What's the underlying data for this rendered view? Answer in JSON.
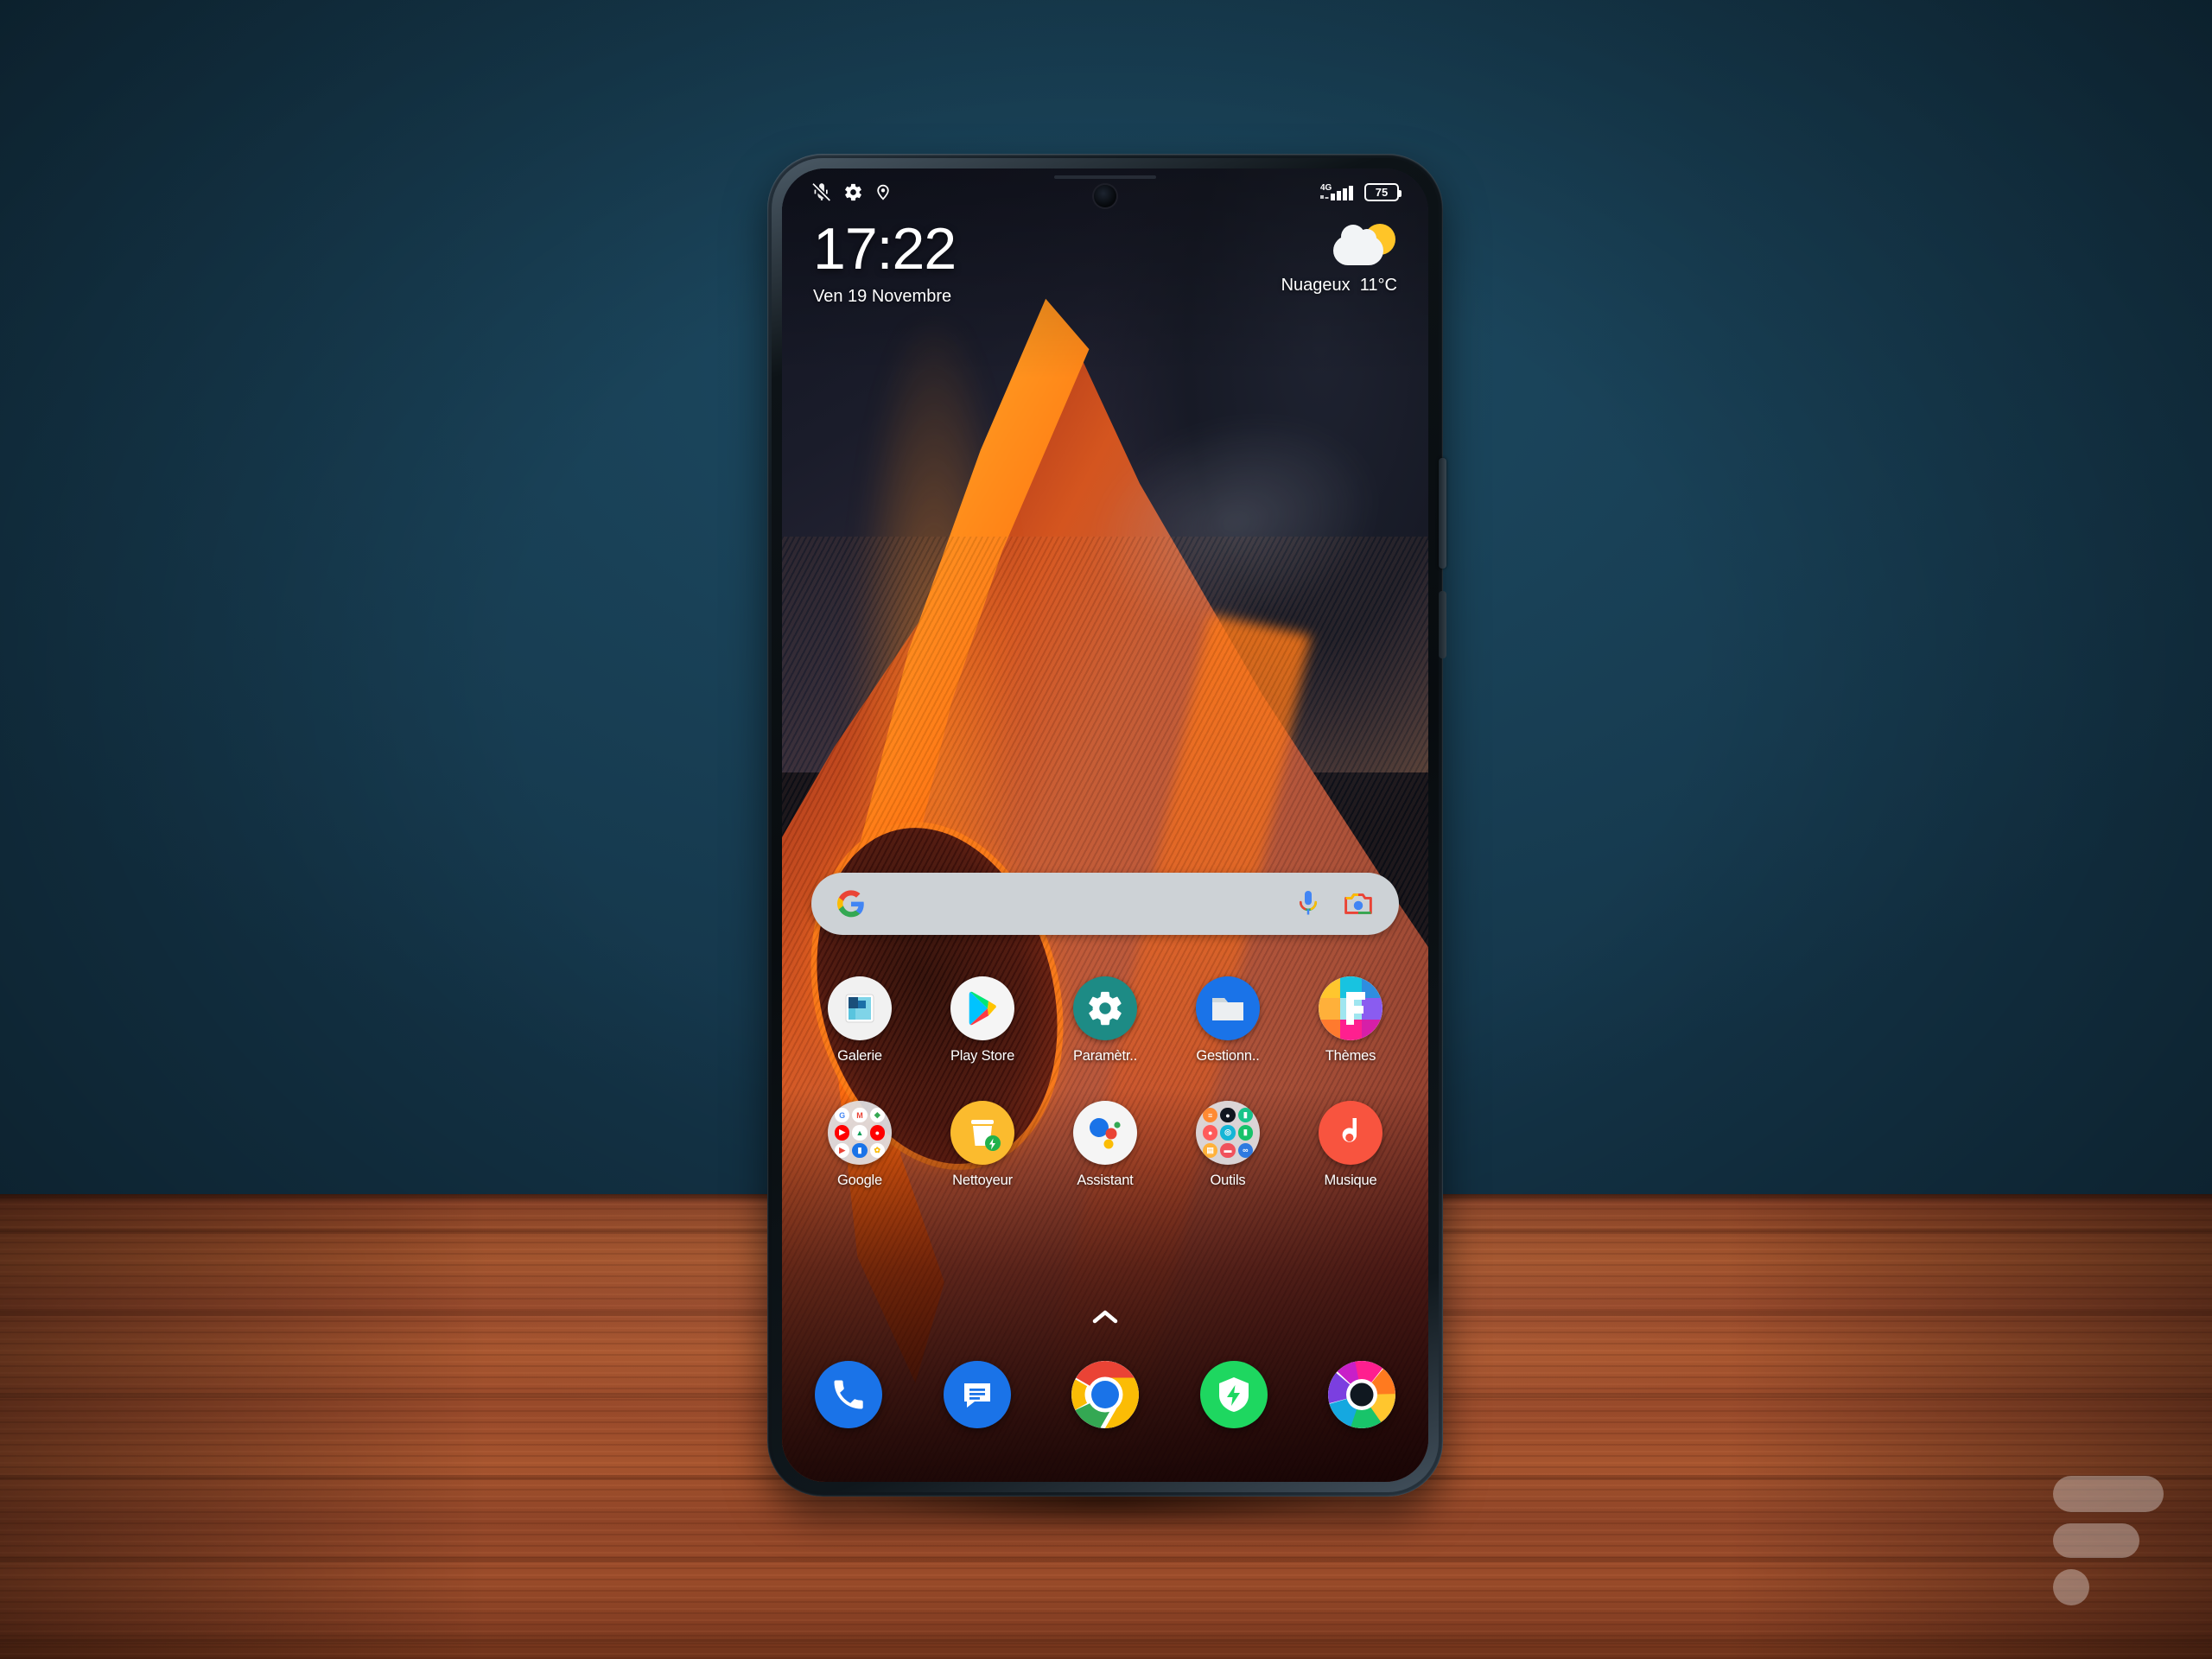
{
  "scene": {
    "background_wall_color": "#194157",
    "table_color": "#a0522c",
    "description": "Smartphone standing upright on a wooden table against a dark teal-blue wall"
  },
  "phone": {
    "device_type": "android-smartphone",
    "frame_color": "#0d1317"
  },
  "status_bar": {
    "left_icons": [
      {
        "name": "vibrate-off-icon",
        "glyph": "bell-muted"
      },
      {
        "name": "gear-icon",
        "glyph": "settings"
      },
      {
        "name": "location-pin-icon",
        "glyph": "location"
      }
    ],
    "network_label": "4G",
    "signal_bars": 4,
    "battery_percent": "75"
  },
  "clock_widget": {
    "time": "17:22",
    "date": "Ven 19 Novembre"
  },
  "weather_widget": {
    "condition": "Nuageux",
    "temperature": "11°C",
    "icon": "partly-cloudy-icon"
  },
  "search": {
    "placeholder": "",
    "value": "",
    "logo": "google-g-icon",
    "mic_icon": "microphone-icon",
    "lens_icon": "google-lens-icon",
    "background_color": "#cdd2d6"
  },
  "app_grid": {
    "rows": [
      {
        "apps": [
          {
            "label": "Galerie",
            "icon": "gallery-icon",
            "bg": "#f0f0f0"
          },
          {
            "label": "Play Store",
            "icon": "play-store-icon",
            "bg": "#f5f5f5"
          },
          {
            "label": "Paramètr..",
            "icon": "settings-gear-icon",
            "bg": "#1f8a84"
          },
          {
            "label": "Gestionn..",
            "icon": "file-manager-icon",
            "bg": "#1a73e8"
          },
          {
            "label": "Thèmes",
            "icon": "themes-icon",
            "bg": "#ff2d8a"
          }
        ]
      },
      {
        "apps": [
          {
            "label": "Google",
            "icon": "google-folder-icon",
            "bg": "#e1e1e4"
          },
          {
            "label": "Nettoyeur",
            "icon": "cleaner-icon",
            "bg": "#fbb залов"
          },
          {
            "label": "Assistant",
            "icon": "google-assistant-icon",
            "bg": "#f5f5f5"
          },
          {
            "label": "Outils",
            "icon": "tools-folder-icon",
            "bg": "#e1e1e4"
          },
          {
            "label": "Musique",
            "icon": "music-icon",
            "bg": "#f8543f"
          }
        ]
      }
    ]
  },
  "app_drawer": {
    "indicator": "chevron-up-icon"
  },
  "dock": {
    "apps": [
      {
        "label": "Téléphone",
        "icon": "phone-icon",
        "bg": "#1a73e8"
      },
      {
        "label": "Messages",
        "icon": "messages-icon",
        "bg": "#1a73e8"
      },
      {
        "label": "Chrome",
        "icon": "chrome-icon",
        "bg": "#ffffff"
      },
      {
        "label": "Sécurité",
        "icon": "security-shield-icon",
        "bg": "#1ed760"
      },
      {
        "label": "Appareil photo",
        "icon": "camera-icon",
        "bg": "#ffffff"
      }
    ]
  },
  "watermark": {
    "name": "site-logo-watermark",
    "shape": "two-rounded-bars-and-dot"
  }
}
